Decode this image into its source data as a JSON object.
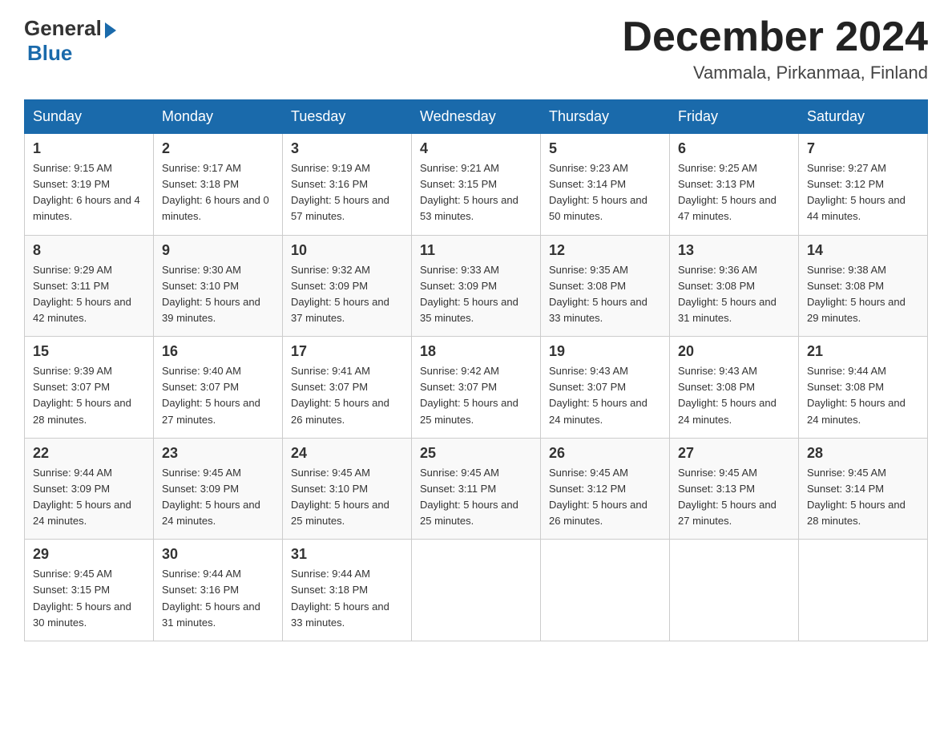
{
  "header": {
    "logo_general": "General",
    "logo_blue": "Blue",
    "month_title": "December 2024",
    "location": "Vammala, Pirkanmaa, Finland"
  },
  "days_of_week": [
    "Sunday",
    "Monday",
    "Tuesday",
    "Wednesday",
    "Thursday",
    "Friday",
    "Saturday"
  ],
  "weeks": [
    [
      {
        "day": 1,
        "sunrise": "9:15 AM",
        "sunset": "3:19 PM",
        "daylight": "6 hours and 4 minutes."
      },
      {
        "day": 2,
        "sunrise": "9:17 AM",
        "sunset": "3:18 PM",
        "daylight": "6 hours and 0 minutes."
      },
      {
        "day": 3,
        "sunrise": "9:19 AM",
        "sunset": "3:16 PM",
        "daylight": "5 hours and 57 minutes."
      },
      {
        "day": 4,
        "sunrise": "9:21 AM",
        "sunset": "3:15 PM",
        "daylight": "5 hours and 53 minutes."
      },
      {
        "day": 5,
        "sunrise": "9:23 AM",
        "sunset": "3:14 PM",
        "daylight": "5 hours and 50 minutes."
      },
      {
        "day": 6,
        "sunrise": "9:25 AM",
        "sunset": "3:13 PM",
        "daylight": "5 hours and 47 minutes."
      },
      {
        "day": 7,
        "sunrise": "9:27 AM",
        "sunset": "3:12 PM",
        "daylight": "5 hours and 44 minutes."
      }
    ],
    [
      {
        "day": 8,
        "sunrise": "9:29 AM",
        "sunset": "3:11 PM",
        "daylight": "5 hours and 42 minutes."
      },
      {
        "day": 9,
        "sunrise": "9:30 AM",
        "sunset": "3:10 PM",
        "daylight": "5 hours and 39 minutes."
      },
      {
        "day": 10,
        "sunrise": "9:32 AM",
        "sunset": "3:09 PM",
        "daylight": "5 hours and 37 minutes."
      },
      {
        "day": 11,
        "sunrise": "9:33 AM",
        "sunset": "3:09 PM",
        "daylight": "5 hours and 35 minutes."
      },
      {
        "day": 12,
        "sunrise": "9:35 AM",
        "sunset": "3:08 PM",
        "daylight": "5 hours and 33 minutes."
      },
      {
        "day": 13,
        "sunrise": "9:36 AM",
        "sunset": "3:08 PM",
        "daylight": "5 hours and 31 minutes."
      },
      {
        "day": 14,
        "sunrise": "9:38 AM",
        "sunset": "3:08 PM",
        "daylight": "5 hours and 29 minutes."
      }
    ],
    [
      {
        "day": 15,
        "sunrise": "9:39 AM",
        "sunset": "3:07 PM",
        "daylight": "5 hours and 28 minutes."
      },
      {
        "day": 16,
        "sunrise": "9:40 AM",
        "sunset": "3:07 PM",
        "daylight": "5 hours and 27 minutes."
      },
      {
        "day": 17,
        "sunrise": "9:41 AM",
        "sunset": "3:07 PM",
        "daylight": "5 hours and 26 minutes."
      },
      {
        "day": 18,
        "sunrise": "9:42 AM",
        "sunset": "3:07 PM",
        "daylight": "5 hours and 25 minutes."
      },
      {
        "day": 19,
        "sunrise": "9:43 AM",
        "sunset": "3:07 PM",
        "daylight": "5 hours and 24 minutes."
      },
      {
        "day": 20,
        "sunrise": "9:43 AM",
        "sunset": "3:08 PM",
        "daylight": "5 hours and 24 minutes."
      },
      {
        "day": 21,
        "sunrise": "9:44 AM",
        "sunset": "3:08 PM",
        "daylight": "5 hours and 24 minutes."
      }
    ],
    [
      {
        "day": 22,
        "sunrise": "9:44 AM",
        "sunset": "3:09 PM",
        "daylight": "5 hours and 24 minutes."
      },
      {
        "day": 23,
        "sunrise": "9:45 AM",
        "sunset": "3:09 PM",
        "daylight": "5 hours and 24 minutes."
      },
      {
        "day": 24,
        "sunrise": "9:45 AM",
        "sunset": "3:10 PM",
        "daylight": "5 hours and 25 minutes."
      },
      {
        "day": 25,
        "sunrise": "9:45 AM",
        "sunset": "3:11 PM",
        "daylight": "5 hours and 25 minutes."
      },
      {
        "day": 26,
        "sunrise": "9:45 AM",
        "sunset": "3:12 PM",
        "daylight": "5 hours and 26 minutes."
      },
      {
        "day": 27,
        "sunrise": "9:45 AM",
        "sunset": "3:13 PM",
        "daylight": "5 hours and 27 minutes."
      },
      {
        "day": 28,
        "sunrise": "9:45 AM",
        "sunset": "3:14 PM",
        "daylight": "5 hours and 28 minutes."
      }
    ],
    [
      {
        "day": 29,
        "sunrise": "9:45 AM",
        "sunset": "3:15 PM",
        "daylight": "5 hours and 30 minutes."
      },
      {
        "day": 30,
        "sunrise": "9:44 AM",
        "sunset": "3:16 PM",
        "daylight": "5 hours and 31 minutes."
      },
      {
        "day": 31,
        "sunrise": "9:44 AM",
        "sunset": "3:18 PM",
        "daylight": "5 hours and 33 minutes."
      },
      null,
      null,
      null,
      null
    ]
  ]
}
